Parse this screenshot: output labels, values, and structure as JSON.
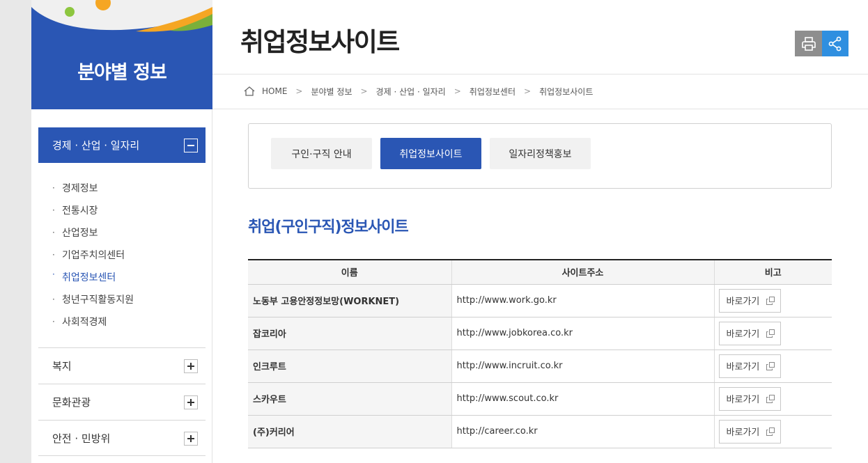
{
  "sidebar": {
    "title": "분야별 정보",
    "active_section": "경제 · 산업 · 일자리",
    "submenu": [
      {
        "label": "경제정보",
        "current": false
      },
      {
        "label": "전통시장",
        "current": false
      },
      {
        "label": "산업정보",
        "current": false
      },
      {
        "label": "기업주치의센터",
        "current": false
      },
      {
        "label": "취업정보센터",
        "current": true
      },
      {
        "label": "청년구직활동지원",
        "current": false
      },
      {
        "label": "사회적경제",
        "current": false
      }
    ],
    "sections": [
      {
        "label": "복지"
      },
      {
        "label": "문화관광"
      },
      {
        "label": "안전 · 민방위"
      }
    ]
  },
  "header": {
    "title": "취업정보사이트",
    "print_icon": "printer-icon",
    "share_icon": "share-icon"
  },
  "breadcrumb": [
    "HOME",
    "분야별 정보",
    "경제 · 산업 · 일자리",
    "취업정보센터",
    "취업정보사이트"
  ],
  "tabs": [
    {
      "label": "구인·구직 안내",
      "active": false
    },
    {
      "label": "취업정보사이트",
      "active": true
    },
    {
      "label": "일자리정책홍보",
      "active": false
    }
  ],
  "section_title": "취업(구인구직)정보사이트",
  "table": {
    "headers": [
      "이름",
      "사이트주소",
      "비고"
    ],
    "rows": [
      {
        "name": "노동부 고용안정정보망(WORKNET)",
        "url": "http://www.work.go.kr",
        "action": "바로가기"
      },
      {
        "name": "잡코리아",
        "url": "http://www.jobkorea.co.kr",
        "action": "바로가기"
      },
      {
        "name": "인크루트",
        "url": "http://www.incruit.co.kr",
        "action": "바로가기"
      },
      {
        "name": "스카우트",
        "url": "http://www.scout.co.kr",
        "action": "바로가기"
      },
      {
        "name": "(주)커리어",
        "url": "http://career.co.kr",
        "action": "바로가기"
      }
    ]
  },
  "colors": {
    "primary": "#2a56b4",
    "share": "#2f8fe0",
    "print": "#8e8e8e"
  }
}
